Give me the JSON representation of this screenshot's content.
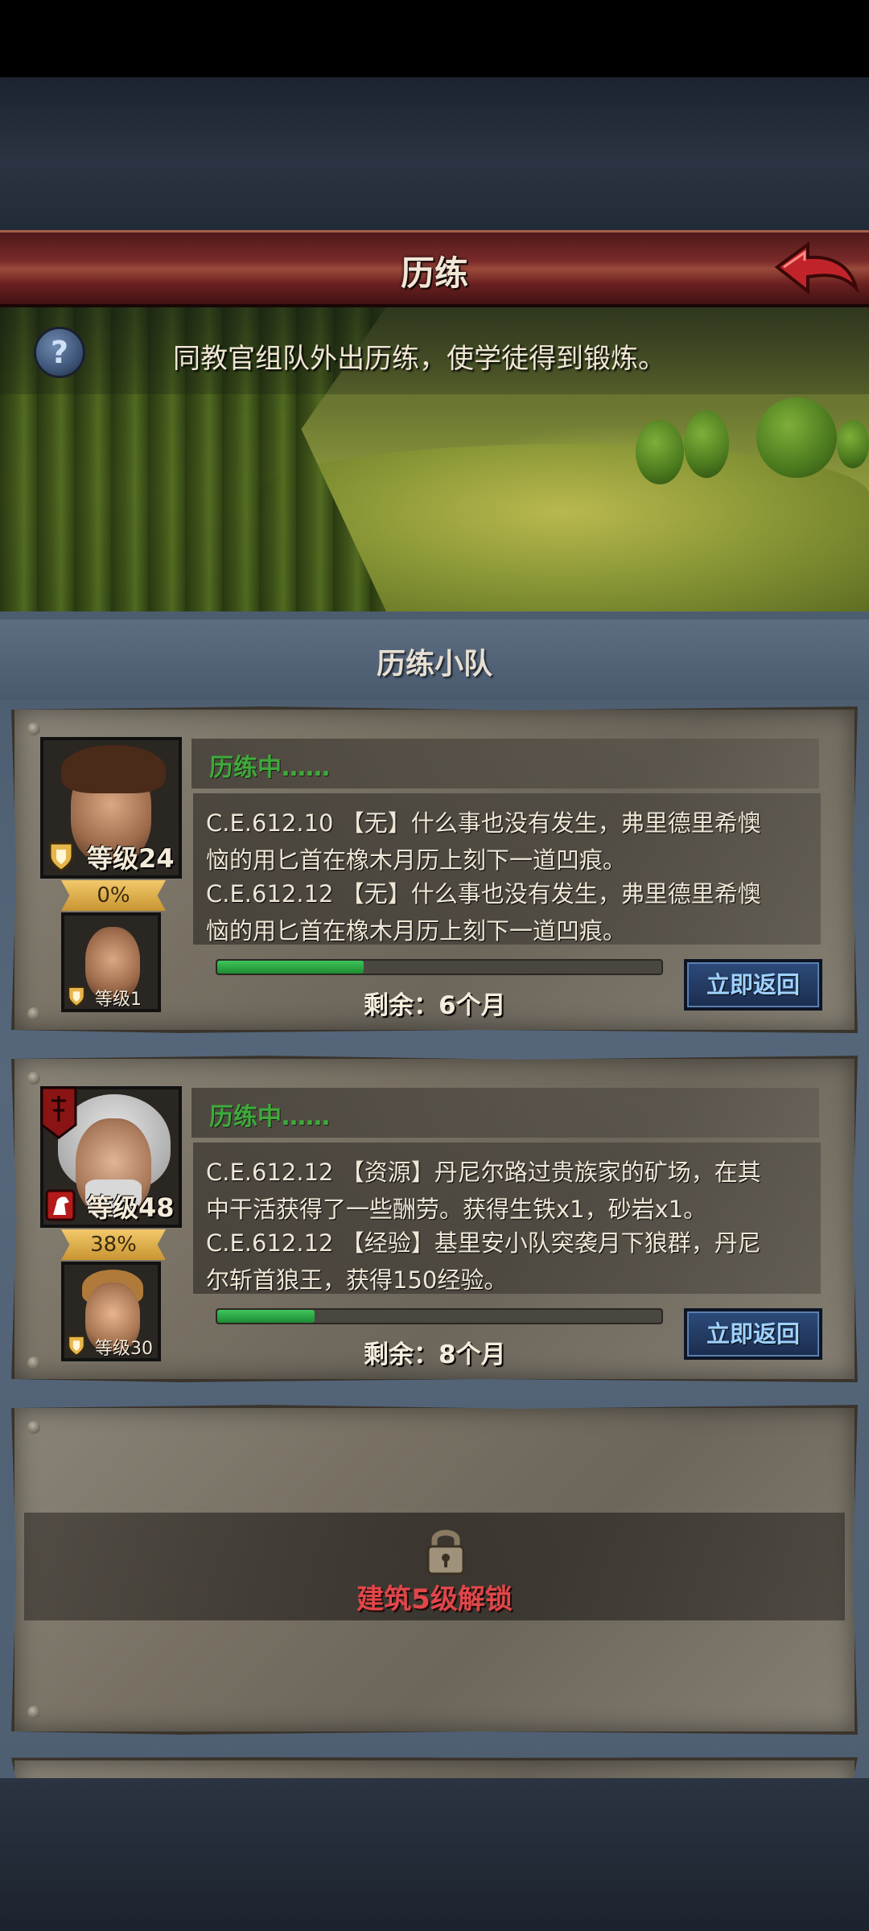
{
  "header": {
    "title": "历练",
    "hint": "同教官组队外出历练，使学徒得到锻炼。",
    "help_glyph": "?"
  },
  "section": {
    "title": "历练小队"
  },
  "squads": [
    {
      "leader_level": "等级24",
      "progress_pct": "0%",
      "apprentice_level": "等级1",
      "status": "历练中……",
      "logs": [
        "C.E.612.10 【无】什么事也没有发生，弗里德里希懊",
        "恼的用匕首在橡木月历上刻下一道凹痕。",
        "C.E.612.12 【无】什么事也没有发生，弗里德里希懊",
        "恼的用匕首在橡木月历上刻下一道凹痕。"
      ],
      "remaining_fraction": 0.33,
      "remaining": "剩余：6个月",
      "return_label": "立即返回"
    },
    {
      "leader_level": "等级48",
      "progress_pct": "38%",
      "apprentice_level": "等级30",
      "status": "历练中……",
      "logs": [
        "C.E.612.12 【资源】丹尼尔路过贵族家的矿场，在其",
        "中干活获得了一些酬劳。获得生铁x1，砂岩x1。",
        "C.E.612.12 【经验】基里安小队突袭月下狼群，丹尼",
        "尔斩首狼王，获得150经验。"
      ],
      "remaining_fraction": 0.22,
      "remaining": "剩余：8个月",
      "return_label": "立即返回"
    }
  ],
  "locked_slot": {
    "text": "建筑5级解锁"
  },
  "colors": {
    "status_green": "#3fa93b",
    "lock_red": "#e0474a",
    "button_text": "#9fd2ff",
    "progress_green": "#2faa45",
    "title_bar": "#7a2a2a"
  }
}
